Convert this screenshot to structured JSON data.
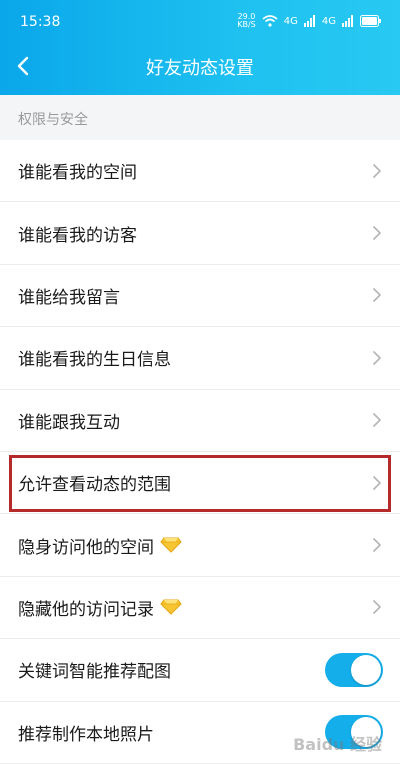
{
  "status_bar": {
    "time": "15:38",
    "speed_value": "29.0",
    "speed_unit": "KB/S",
    "signal1_label": "4G",
    "signal2_label": "4G"
  },
  "header": {
    "title": "好友动态设置",
    "back_icon": "chevron-left-icon"
  },
  "section": {
    "title": "权限与安全"
  },
  "rows": [
    {
      "label": "谁能看我的空间",
      "type": "nav"
    },
    {
      "label": "谁能看我的访客",
      "type": "nav"
    },
    {
      "label": "谁能给我留言",
      "type": "nav"
    },
    {
      "label": "谁能看我的生日信息",
      "type": "nav"
    },
    {
      "label": "谁能跟我互动",
      "type": "nav"
    },
    {
      "label": "允许查看动态的范围",
      "type": "nav",
      "highlighted": true
    },
    {
      "label": "隐身访问他的空间",
      "type": "nav",
      "badge": "diamond-icon"
    },
    {
      "label": "隐藏他的访问记录",
      "type": "nav",
      "badge": "diamond-icon"
    },
    {
      "label": "关键词智能推荐配图",
      "type": "toggle",
      "on": true
    },
    {
      "label": "推荐制作本地照片",
      "type": "toggle",
      "on": true
    }
  ],
  "colors": {
    "accent": "#14aeea",
    "highlight": "#b52a2a"
  }
}
